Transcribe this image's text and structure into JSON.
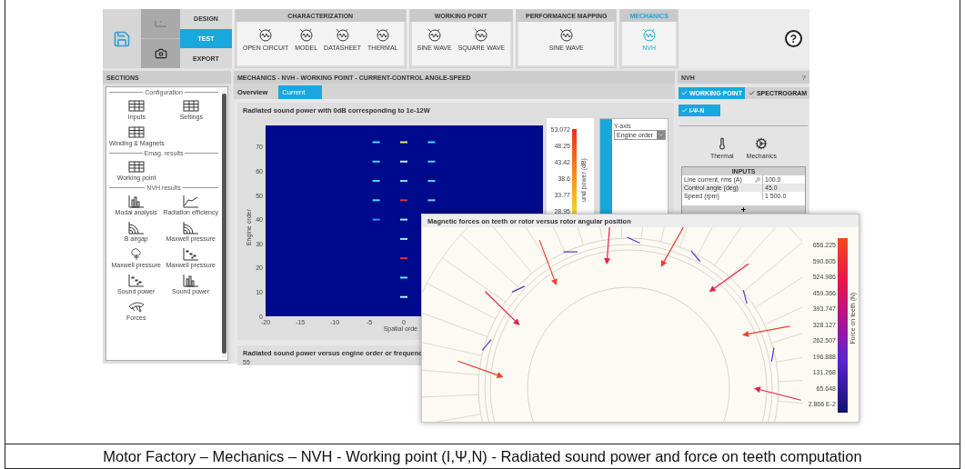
{
  "toolbar": {
    "modes": [
      {
        "label": "DESIGN",
        "selected": false
      },
      {
        "label": "TEST",
        "selected": true
      },
      {
        "label": "EXPORT",
        "selected": false
      }
    ],
    "groups": [
      {
        "title": "CHARACTERIZATION",
        "selected": false,
        "items": [
          {
            "label": "OPEN CIRCUIT"
          },
          {
            "label": "MODEL"
          },
          {
            "label": "DATASHEET"
          },
          {
            "label": "THERMAL"
          }
        ]
      },
      {
        "title": "WORKING POINT",
        "selected": false,
        "items": [
          {
            "label": "SINE WAVE"
          },
          {
            "label": "SQUARE WAVE"
          }
        ]
      },
      {
        "title": "PERFORMANCE MAPPING",
        "selected": false,
        "items": [
          {
            "label": "SINE WAVE"
          }
        ]
      },
      {
        "title": "MECHANICS",
        "selected": true,
        "items": [
          {
            "label": "NVH"
          }
        ]
      }
    ],
    "help": "?"
  },
  "sidebar": {
    "title": "SECTIONS",
    "sections": [
      {
        "title": "Configuration",
        "items": [
          {
            "label": "Inputs",
            "kind": "table"
          },
          {
            "label": "Settings",
            "kind": "table"
          },
          {
            "label": "Winding & Magnets",
            "kind": "table"
          }
        ]
      },
      {
        "title": "Emag. results",
        "items": [
          {
            "label": "Working point",
            "kind": "table"
          }
        ]
      },
      {
        "title": "NVH results",
        "items": [
          {
            "label": "Modal analysis",
            "kind": "bars"
          },
          {
            "label": "Radiation efficiency",
            "kind": "curve"
          },
          {
            "label": "B airgap",
            "kind": "arcs"
          },
          {
            "label": "Maxwell pressure",
            "kind": "arcs"
          },
          {
            "label": "Maxwell pressure",
            "kind": "blob"
          },
          {
            "label": "Maxwell pressure",
            "kind": "scatter"
          },
          {
            "label": "Sound power",
            "kind": "scatter"
          },
          {
            "label": "Sound power",
            "kind": "bars"
          },
          {
            "label": "Forces",
            "kind": "fan"
          }
        ]
      }
    ]
  },
  "main": {
    "title": "MECHANICS - NVH - WORKING POINT - CURRENT-CONTROL ANGLE-SPEED",
    "tabs": [
      {
        "label": "Overview",
        "selected": false
      },
      {
        "label": "Current",
        "selected": true
      }
    ],
    "heatmap": {
      "title": "Radiated sound power with 0dB corresponding to 1e-12W",
      "ylabel": "Engine order",
      "xlabel": "Spatial orde",
      "xticks": [
        "-20",
        "-15",
        "-10",
        "-5",
        "0"
      ],
      "yticks": [
        "70",
        "60",
        "50",
        "40",
        "30",
        "20",
        "10",
        "0"
      ],
      "colorbar_ticks": [
        "53.072",
        "48.25",
        "43.42",
        "38.6",
        "33.77",
        "28.95"
      ],
      "colorbar_label": "und power (dB)",
      "axis_select": {
        "label": "Y-axis",
        "value": "Engine order"
      }
    },
    "second_chart": {
      "title": "Radiated sound power versus engine order or frequenc",
      "yticks": [
        "55"
      ]
    }
  },
  "nvh_panel": {
    "title": "NVH",
    "help": "?",
    "tabs": [
      {
        "label": "WORKING POINT",
        "selected": true
      },
      {
        "label": "SPECTROGRAM",
        "selected": false
      }
    ],
    "subtabs": [
      {
        "label": "I-Ψ-N",
        "selected": true
      }
    ],
    "tools": [
      {
        "label": "Thermal",
        "kind": "thermometer"
      },
      {
        "label": "Mechanics",
        "kind": "gears"
      }
    ],
    "inputs": {
      "title": "INPUTS",
      "rows": [
        {
          "name": "Line current, rms (A)",
          "value": "100.0"
        },
        {
          "name": "Control angle (deg)",
          "value": "45.0"
        },
        {
          "name": "Speed (rpm)",
          "value": "1 500.0"
        }
      ],
      "add": "+"
    }
  },
  "forces_popup": {
    "title": "Magnetic forces on teeth or rotor versus rotor angular position",
    "colorbar_ticks": [
      "656.225",
      "590.605",
      "524.986",
      "459.366",
      "393.747",
      "328.127",
      "262.507",
      "196.888",
      "131.268",
      "65.648",
      "2.866 E-2"
    ],
    "colorbar_label": "Force on teeth (N)"
  },
  "caption": "Motor Factory – Mechanics – NVH - Working point (I,Ψ,N) - Radiated sound power and force on teeth computation"
}
